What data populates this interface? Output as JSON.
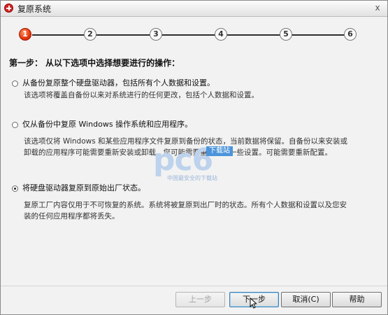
{
  "window": {
    "title": "复原系统",
    "close_label": "x"
  },
  "wizard": {
    "steps": [
      "1",
      "2",
      "3",
      "4",
      "5",
      "6"
    ],
    "active_step": 1
  },
  "content": {
    "heading": "第一步：   从以下选项中选择想要进行的操作：",
    "options": [
      {
        "label": "从备份复原整个硬盘驱动器，包括所有个人数据和设置。",
        "selected": false,
        "description": [
          "该选项将覆盖自备份以来对系统进行的任何更改，包括个人数据和设置。"
        ]
      },
      {
        "label": "仅从备份中复原 Windows 操作系统和应用程序。",
        "selected": false,
        "description": [
          "该选项仅将 Windows 和某些应用程序文件复原到备份的状态，当前数据将保留。自备份以来安装或",
          "卸载的应用程序可能需要重新安装或卸载。您可能需要重新配置一些设置。可能需要重新配置。"
        ]
      },
      {
        "label": "将硬盘驱动器复原到原始出厂状态。",
        "selected": true,
        "description": [
          "复原工厂内容仅用于不可恢复的系统。系统将被复原到出厂时的状态。所有个人数据和设置以及您安",
          "装的任何应用程序都将丢失。"
        ]
      }
    ]
  },
  "watermark": {
    "main": "pc6",
    "tag": "下载站",
    "sub": "中国最安全的下载站"
  },
  "buttons": {
    "prev": "上一步",
    "next": "下一步",
    "cancel": "取消(C)",
    "help": "帮助"
  },
  "colors": {
    "active_step": "#e2350b",
    "button_focus": "#3c7fb1",
    "watermark": "#bdd2ec"
  }
}
